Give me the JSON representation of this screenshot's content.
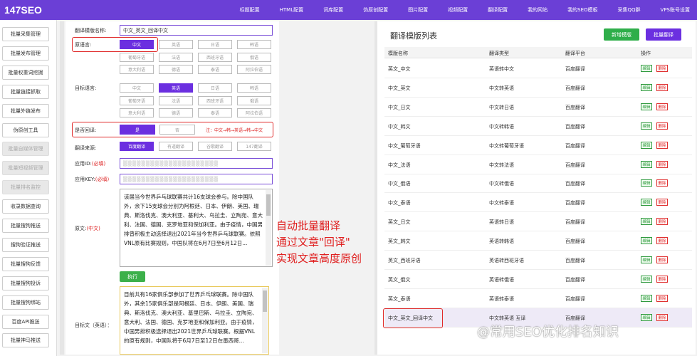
{
  "app": {
    "logo": "147SEO"
  },
  "topnav": [
    "标题配置",
    "HTML配置",
    "词库配置",
    "伪原创配置",
    "图片配置",
    "视频配置",
    "翻译配置",
    "我的网站",
    "我的SEO模板",
    "采集QQ群",
    "VPS账号设置"
  ],
  "sidebar": [
    {
      "label": "批量采集管理",
      "disabled": false
    },
    {
      "label": "批量发布管理",
      "disabled": false
    },
    {
      "label": "批量权重词挖掘",
      "disabled": false
    },
    {
      "label": "批量链接抓取",
      "disabled": false
    },
    {
      "label": "批量外链发布",
      "disabled": false
    },
    {
      "label": "伪原创工具",
      "disabled": false
    },
    {
      "label": "批量自媒体管理",
      "disabled": true
    },
    {
      "label": "批量短视频管理",
      "disabled": true
    },
    {
      "label": "批量排名监控",
      "disabled": true
    },
    {
      "label": "收录数据查询",
      "disabled": false
    },
    {
      "label": "批量搜狗推送",
      "disabled": false
    },
    {
      "label": "搜狗验证推送",
      "disabled": false
    },
    {
      "label": "批量搜狗反馈",
      "disabled": false
    },
    {
      "label": "批量搜狗投诉",
      "disabled": false
    },
    {
      "label": "批量搜狗绑站",
      "disabled": false
    },
    {
      "label": "百度API推送",
      "disabled": false
    },
    {
      "label": "批量神马推送",
      "disabled": false
    }
  ],
  "form": {
    "template_name_label": "翻译模版名称:",
    "template_name_value": "中文_英文_回译中文",
    "source_lang_label": "原语言:",
    "source_langs": [
      "中文",
      "英语",
      "日语",
      "韩语",
      "葡萄牙语",
      "法语",
      "西班牙语",
      "俄语",
      "意大利语",
      "德语",
      "泰语",
      "阿拉伯语"
    ],
    "source_selected": "中文",
    "target_lang_label": "目标语言:",
    "target_langs": [
      "中文",
      "英语",
      "日语",
      "韩语",
      "葡萄牙语",
      "法语",
      "西班牙语",
      "俄语",
      "意大利语",
      "德语",
      "泰语",
      "阿拉伯语"
    ],
    "target_selected": "英语",
    "back_translate_label": "是否回译:",
    "back_yes": "是",
    "back_no": "否",
    "back_note": "注：中文→韩→英语→韩→中文",
    "source_label": "翻译来源:",
    "sources": [
      "百度翻译",
      "有道翻译",
      "谷歌翻译",
      "147翻译"
    ],
    "source_selected_engine": "百度翻译",
    "appid_label": "应用ID:",
    "appid_req": "(必填)",
    "appid_value": "▒▒▒▒▒▒▒▒▒▒▒▒▒▒▒▒▒▒▒▒▒",
    "appkey_label": "应用KEY:",
    "appkey_req": "(必填)",
    "appkey_value": "▒▒▒▒▒▒▒▒▒▒▒▒▒▒▒▒▒▒▒▒▒",
    "original_label": "原文:",
    "original_hint": "(中文)",
    "original_text": "该届当今世界乒乓球联赛共计16支球会参与。除中国队外，余下15支球会分别为阿根廷、日本、伊朗、美国、瑞典、斯洛伐克、澳大利亚、基利大、乌拉圭、立陶宛、意大利、法国、德国、克罗地亚和保加利亚。由于疫情，中国男排曾积极主动选择退出2021年当今世界乒乓球联赛。依照VNL原有比赛规则，中国队将在6月7日至6月12日...",
    "run_button": "执行",
    "result_label": "目标文（英语）：",
    "result_text": "目前共有16家俱乐部参加了世界乒乓球联赛。除中国队外，其余15家俱乐部是阿根廷、日本、伊朗、美国、瑞典、斯洛伐克、澳大利亚、基里巴斯、乌拉圭、立陶宛、意大利、法国、德国、克罗地亚和保加利亚。由于疫情，中国男排积极选择退出2021世界乒乓球联赛。根据VNL的原有规则，中国队将于6月7日至12日在墨西哥..."
  },
  "annotation": [
    "自动批量翻译",
    "通过文章\"回译\"",
    "实现文章高度原创"
  ],
  "list": {
    "title": "翻译模版列表",
    "add_button": "新增模版",
    "batch_button": "批量翻译",
    "headers": [
      "模版名称",
      "翻译类型",
      "翻译平台",
      "操作"
    ],
    "edit_label": "编辑",
    "delete_label": "删除",
    "rows": [
      {
        "name": "英文_中文",
        "type": "英语转中文",
        "platform": "百度翻译"
      },
      {
        "name": "中文_英文",
        "type": "中文转英语",
        "platform": "百度翻译"
      },
      {
        "name": "中文_日文",
        "type": "中文转日语",
        "platform": "百度翻译"
      },
      {
        "name": "中文_韩文",
        "type": "中文转韩语",
        "platform": "百度翻译"
      },
      {
        "name": "中文_葡萄牙语",
        "type": "中文转葡萄牙语",
        "platform": "百度翻译"
      },
      {
        "name": "中文_法语",
        "type": "中文转法语",
        "platform": "百度翻译"
      },
      {
        "name": "中文_俄语",
        "type": "中文转俄语",
        "platform": "百度翻译"
      },
      {
        "name": "中文_泰语",
        "type": "中文转泰语",
        "platform": "百度翻译"
      },
      {
        "name": "英文_日文",
        "type": "英语转日语",
        "platform": "百度翻译"
      },
      {
        "name": "英文_韩文",
        "type": "英语转韩语",
        "platform": "百度翻译"
      },
      {
        "name": "英文_西班牙语",
        "type": "英语转西班牙语",
        "platform": "百度翻译"
      },
      {
        "name": "英文_俄文",
        "type": "英语转俄语",
        "platform": "百度翻译"
      },
      {
        "name": "英文_泰语",
        "type": "英语转泰语",
        "platform": "百度翻译"
      },
      {
        "name": "中文_英文_回译中文",
        "type": "中文转英语 互译",
        "platform": "百度翻译"
      }
    ]
  },
  "watermark": "@常用SEO优化排名知识",
  "colors": {
    "brand": "#6b3fd6",
    "selected": "#6b2fe0",
    "success": "#2fae4a",
    "danger": "#e02b2b"
  }
}
